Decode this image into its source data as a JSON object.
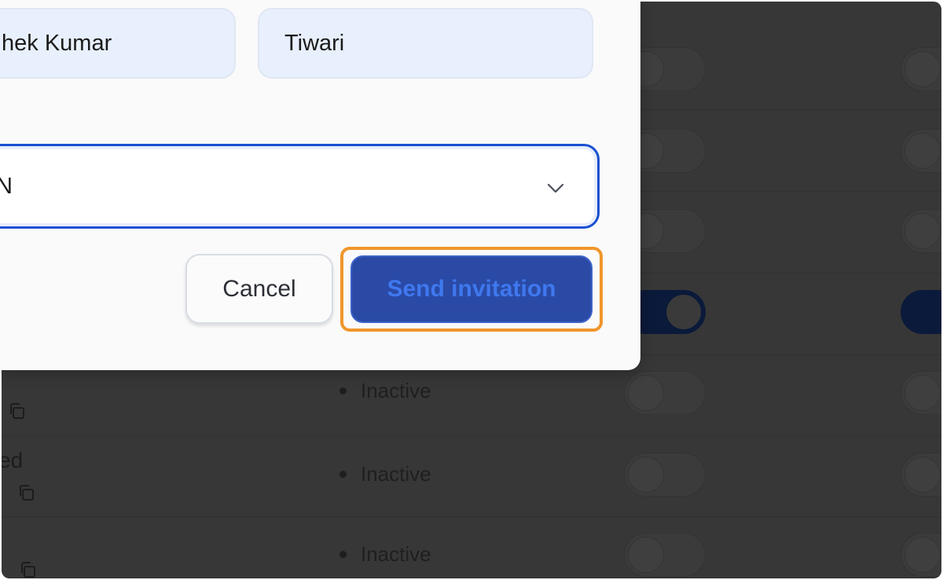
{
  "modal": {
    "first_name_value": "hek Kumar",
    "last_name_value": "Tiwari",
    "role_select_value": "N",
    "cancel_label": "Cancel",
    "send_label": "Send invitation"
  },
  "background": {
    "statuses": [
      "Inactive",
      "Inactive",
      "Inactive"
    ],
    "fragment_text": "ed",
    "toggles_on_row": 4
  },
  "colors": {
    "accent": "#2a4aa6",
    "focus_outline": "#1a4fd0",
    "highlight": "#f0962b"
  }
}
